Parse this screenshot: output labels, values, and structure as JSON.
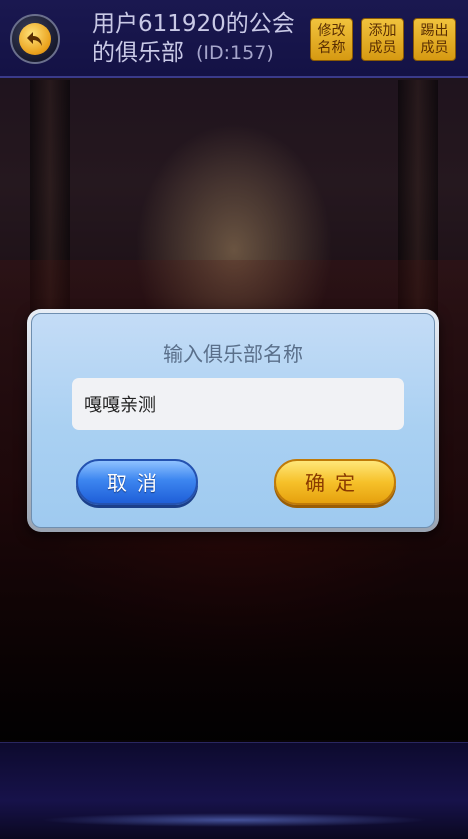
{
  "header": {
    "title": "用户611920的公会的俱乐部",
    "club_id": "(ID:157)",
    "buttons": [
      {
        "label": "修改名称"
      },
      {
        "label": "添加成员"
      },
      {
        "label": "踢出成员"
      }
    ]
  },
  "dialog": {
    "title": "输入俱乐部名称",
    "input_value": "嘎嘎亲测",
    "cancel_label": "取消",
    "confirm_label": "确定"
  }
}
